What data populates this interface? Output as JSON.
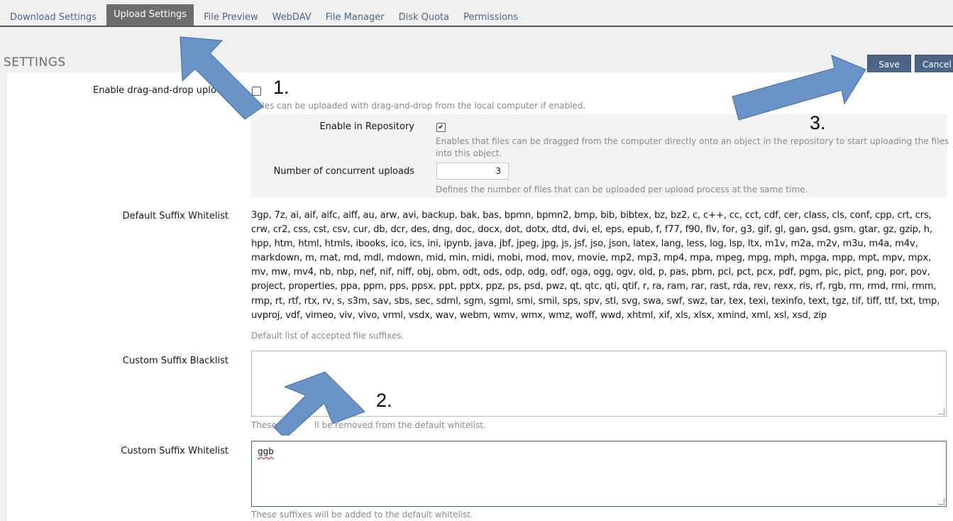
{
  "tabs": [
    {
      "label": "Download Settings"
    },
    {
      "label": "Upload Settings"
    },
    {
      "label": "File Preview"
    },
    {
      "label": "WebDAV"
    },
    {
      "label": "File Manager"
    },
    {
      "label": "Disk Quota"
    },
    {
      "label": "Permissions"
    }
  ],
  "page_title": "SETTINGS",
  "buttons": {
    "save": "Save",
    "cancel": "Cancel"
  },
  "dnd": {
    "label": "Enable drag-and-drop uplo",
    "help": "Files can be uploaded with drag-and-drop from the local computer if enabled.",
    "repo_label": "Enable in Repository",
    "repo_checked": true,
    "repo_help_line1": "Enables that files can be dragged from the computer directly onto an object in the repository to start uploading the files",
    "repo_help_line2": "into this object.",
    "concurrent_label": "Number of concurrent uploads",
    "concurrent_value": "3",
    "concurrent_help": "Defines the number of files that can be uploaded per upload process at the same time."
  },
  "default_whitelist": {
    "label": "Default Suffix Whitelist",
    "value": "3gp, 7z, ai, aif, aifc, aiff, au, arw, avi, backup, bak, bas, bpmn, bpmn2, bmp, bib, bibtex, bz, bz2, c, c++, cc, cct, cdf, cer, class, cls, conf, cpp, crt, crs, crw, cr2, css, cst, csv, cur, db, dcr, des, dng, doc, docx, dot, dotx, dtd, dvi, el, eps, epub, f, f77, f90, flv, for, g3, gif, gl, gan, gsd, gsm, gtar, gz, gzip, h, hpp, htm, html, htmls, ibooks, ico, ics, ini, ipynb, java, jbf, jpeg, jpg, js, jsf, jso, json, latex, lang, less, log, lsp, ltx, m1v, m2a, m2v, m3u, m4a, m4v, markdown, m, mat, md, mdl, mdown, mid, min, midi, mobi, mod, mov, movie, mp2, mp3, mp4, mpa, mpeg, mpg, mph, mpga, mpp, mpt, mpv, mpx, mv, mw, mv4, nb, nbp, nef, nif, niff, obj, obm, odt, ods, odp, odg, odf, oga, ogg, ogv, old, p, pas, pbm, pcl, pct, pcx, pdf, pgm, pic, pict, png, por, pov, project, properties, ppa, ppm, pps, ppsx, ppt, pptx, ppz, ps, psd, pwz, qt, qtc, qti, qtif, r, ra, ram, rar, rast, rda, rev, rexx, ris, rf, rgb, rm, rmd, rmi, rmm, rmp, rt, rtf, rtx, rv, s, s3m, sav, sbs, sec, sdml, sgm, sgml, smi, smil, sps, spv, stl, svg, swa, swf, swz, tar, tex, texi, texinfo, text, tgz, tif, tiff, ttf, txt, tmp, uvproj, vdf, vimeo, viv, vivo, vrml, vsdx, wav, webm, wmv, wmx, wmz, woff, wwd, xhtml, xif, xls, xlsx, xmind, xml, xsl, xsd, zip",
    "help": "Default list of accepted file suffixes."
  },
  "custom_blacklist": {
    "label": "Custom Suffix Blacklist",
    "value": "",
    "help_visible": "These s",
    "help_visible_end": "ll be removed from the default whitelist."
  },
  "custom_whitelist": {
    "label": "Custom Suffix Whitelist",
    "value": "ggb",
    "help": "These suffixes will be added to the default whitelist."
  },
  "annotations": {
    "step1": "1.",
    "step2": "2.",
    "step3": "3."
  },
  "colors": {
    "accent": "#4c6586",
    "arrow": "#6a93c8",
    "tab_active": "#6d6d6d"
  }
}
